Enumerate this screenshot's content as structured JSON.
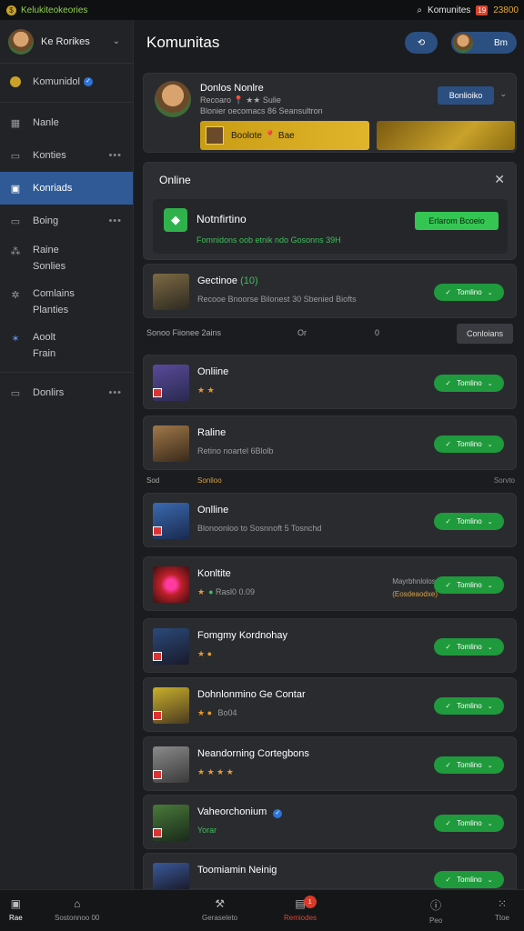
{
  "topbar": {
    "brand": "Kelukiteokeories",
    "search_label": "Komunites",
    "badge": "19",
    "count": "23800"
  },
  "sidebar": {
    "profile_name": "Ke Rorikes",
    "items": [
      {
        "label": "Komunidol",
        "icon": "coin-icon",
        "verified": true
      },
      {
        "label": "Nanle",
        "icon": "grid-icon"
      },
      {
        "label": "Konties",
        "icon": "square-icon",
        "more": "•••"
      },
      {
        "label": "Konriads",
        "icon": "chat-icon",
        "active": true
      },
      {
        "label": "Boing",
        "icon": "square-icon",
        "more": "•••"
      },
      {
        "label": "Raine",
        "label2": "Sonlies",
        "icon": "network-icon"
      },
      {
        "label": "Comlains",
        "label2": "Planties",
        "icon": "gear-icon"
      },
      {
        "label": "Aoolt",
        "label2": "Frain",
        "icon": "star-icon"
      },
      {
        "label": "Donlirs",
        "icon": "square-icon",
        "more": "•••"
      }
    ]
  },
  "header": {
    "title": "Komunitas",
    "btn_icon": "refresh-icon",
    "profile_label": "Bm"
  },
  "featured": {
    "title": "Donlos Nonlre",
    "line2": "Recoaro 📍 ★★ Sulie",
    "line3": "Blonier oecomacs 86 Seansultron",
    "button": "Bonlioiko",
    "banner_text": "Boolote 📍 Bae"
  },
  "online_panel": {
    "title": "Online",
    "name": "Notnfirtino",
    "sub": "Fomnidons oob etnik ndo Gosonns 39H",
    "button": "Erlarom Bcoeio"
  },
  "rows": [
    {
      "name": "Gectinoe",
      "tag": "(10)",
      "sub": "Recooe Bnoorse Bilonest 30 Sbenied Biofts",
      "button": "Tomlino"
    },
    {
      "name": "Onliine",
      "sub": "★ ★",
      "button": "Tomlino"
    },
    {
      "name": "Raline",
      "sub": "Retino noartel 6Blolb",
      "button": "Tomlino"
    },
    {
      "name": "Onlline",
      "sub": "Blonoonloo to Sosnnoft 5 Tosnchd",
      "button": "Tomlino"
    },
    {
      "name": "Konltite",
      "sub": "Rasl0 0.09",
      "meta1": "Mayrbhnlolos",
      "meta2": "(Eosdeaodxe)",
      "button": "Tomlino"
    },
    {
      "name": "Fomgmy Kordnohay",
      "sub": "★ ●",
      "button": "Tomlino"
    },
    {
      "name": "Dohnlonmino Ge Contar",
      "sub": "Bo04",
      "button": "Tomlino"
    },
    {
      "name": "Neandorning Cortegbons",
      "sub": "★ ★ ★ ★",
      "button": "Tomlino"
    },
    {
      "name": "Vaheorchonium",
      "sub": "Yorar",
      "button": "Tomlino"
    },
    {
      "name": "Toomiamin Neinig",
      "sub": "★ ★",
      "button": "Tomlino"
    }
  ],
  "tabs": {
    "t1": "Sonoo Fiionee 2ains",
    "t2": "Or",
    "t3": "0",
    "btn": "Conloians"
  },
  "sections": {
    "left": "Sod",
    "mid": "Sonlioo",
    "right": "Sorvto"
  },
  "bottom_nav": [
    {
      "label": "Rae",
      "icon": "home-icon"
    },
    {
      "label": "Sostonnoo 00",
      "icon": "house-icon"
    },
    {
      "label": "Geraseleto",
      "icon": "hammer-icon"
    },
    {
      "label": "Remiodes",
      "icon": "store-icon",
      "badge": "1"
    },
    {
      "label": "Peo",
      "icon": "info-icon"
    },
    {
      "label": "Ttoe",
      "icon": "dots-icon"
    }
  ]
}
